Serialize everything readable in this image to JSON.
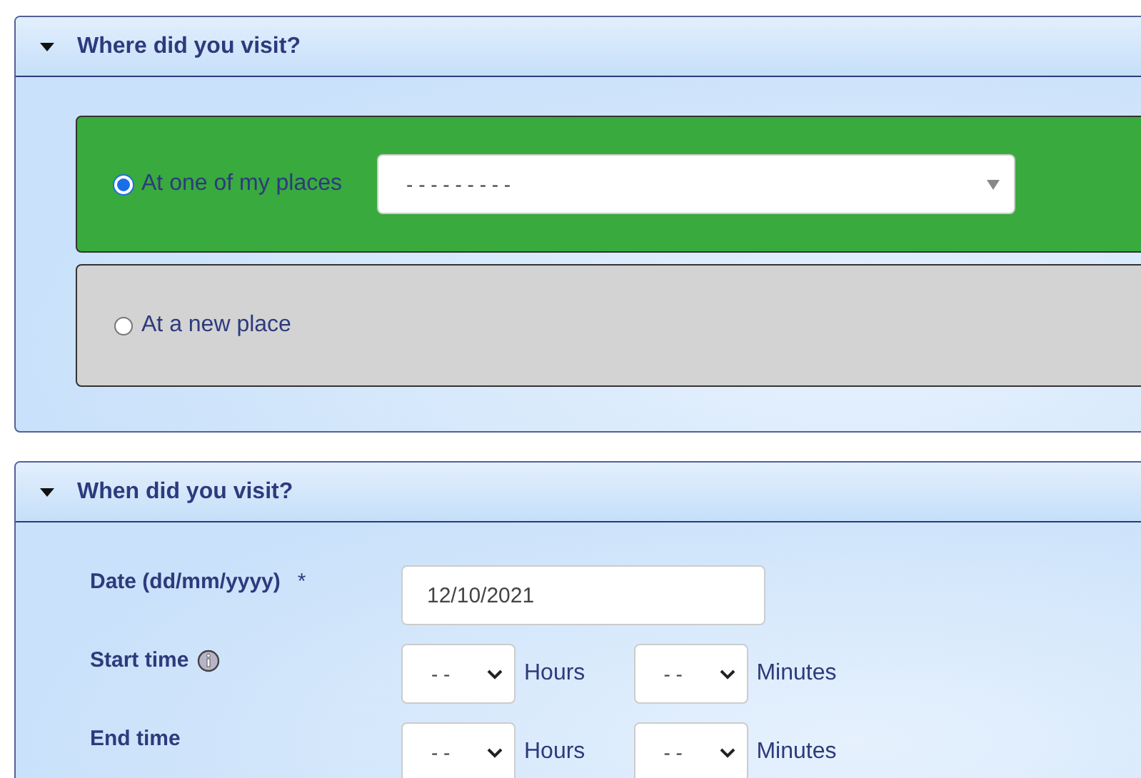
{
  "sections": [
    {
      "kind": "location",
      "title": "Where did you visit?",
      "expanded": true,
      "options": [
        {
          "label": "At one of my places",
          "selected": true,
          "select_value": "- - - - - - - - -"
        },
        {
          "label": "At a new place",
          "selected": false
        }
      ]
    },
    {
      "kind": "time",
      "title": "When did you visit?",
      "expanded": true,
      "fields": [
        {
          "kind": "date",
          "label": "Date (dd/mm/yyyy)",
          "required_mark": "*",
          "value": "12/10/2021"
        },
        {
          "kind": "time",
          "label": "Start time",
          "info": true,
          "hours": "- -",
          "hours_unit": "Hours",
          "minutes": "- -",
          "minutes_unit": "Minutes"
        },
        {
          "kind": "time",
          "label": "End time",
          "info": false,
          "hours": "- -",
          "hours_unit": "Hours",
          "minutes": "- -",
          "minutes_unit": "Minutes"
        }
      ]
    }
  ]
}
